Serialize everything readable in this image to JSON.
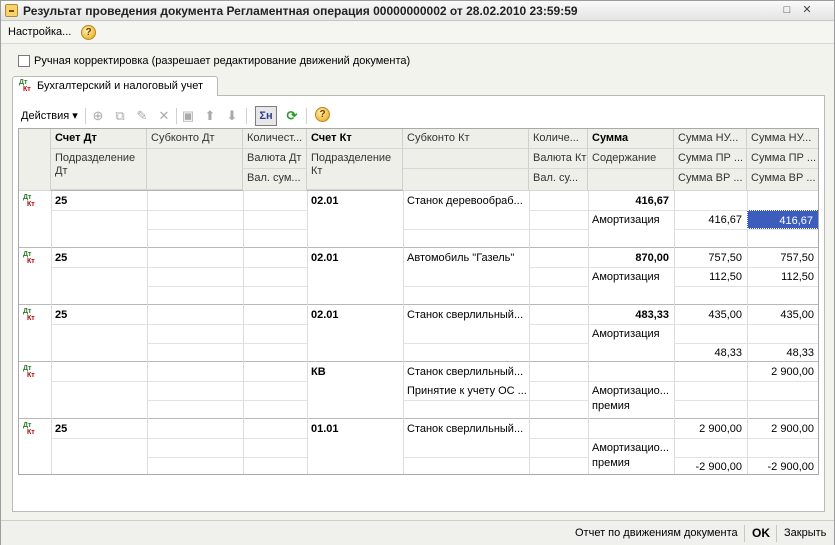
{
  "window": {
    "title": "Результат проведения документа Регламентная операция 00000000002 от 28.02.2010 23:59:59",
    "maximize_glyph": "□",
    "close_glyph": "✕"
  },
  "menu": {
    "settings_label": "Настройка...",
    "help_glyph": "?"
  },
  "manual_correction": {
    "label": "Ручная корректировка (разрешает редактирование движений документа)",
    "checked": false
  },
  "tab": {
    "label": "Бухгалтерский и налоговый учет",
    "icon_dt": "Дт",
    "icon_kt": "Кт"
  },
  "toolbar": {
    "actions_label": "Действия ▾",
    "sum_label": "Σн",
    "icons": [
      "add-icon",
      "copy-icon",
      "edit-icon",
      "delete-icon",
      "save-icon",
      "move-up-icon",
      "move-down-icon",
      "sum-icon",
      "refresh-icon",
      "help-icon"
    ]
  },
  "grid": {
    "headers": {
      "schet_dt": "Счет Дт",
      "subkonto_dt": "Субконто Дт",
      "kolichestvo_dt": "Количест...",
      "schet_kt": "Счет Кт",
      "subkonto_kt": "Субконто Кт",
      "kolichestvo_kt": "Количе...",
      "summa": "Сумма",
      "summa_nu_dt": "Сумма НУ...",
      "summa_nu_kt": "Сумма НУ...",
      "podrazdelenie_dt": "Подразделение Дт",
      "valyuta_dt": "Валюта Дт",
      "podrazdelenie_kt": "Подразделение Кт",
      "valyuta_kt": "Валюта Кт",
      "soderzhanie": "Содержание",
      "summa_pr_dt": "Сумма ПР ...",
      "summa_pr_kt": "Сумма ПР ...",
      "val_summa_dt": "Вал. сум...",
      "val_summa_kt": "Вал. су...",
      "summa_vr_dt": "Сумма ВР ...",
      "summa_vr_kt": "Сумма ВР ..."
    },
    "rows": [
      {
        "schet_dt": "25",
        "schet_kt": "02.01",
        "subkonto_kt": "Станок деревообраб...",
        "subkonto_kt2": "",
        "summa": "416,67",
        "soderzhanie": "Амортизация",
        "soderzhanie2": "",
        "nu_dt": "",
        "nu_kt": "",
        "pr_dt": "416,67",
        "pr_kt": "416,67",
        "vr_dt": "",
        "vr_kt": ""
      },
      {
        "schet_dt": "25",
        "schet_kt": "02.01",
        "subkonto_kt": "Автомобиль \"Газель\"",
        "subkonto_kt2": "",
        "summa": "870,00",
        "soderzhanie": "Амортизация",
        "soderzhanie2": "",
        "nu_dt": "757,50",
        "nu_kt": "757,50",
        "pr_dt": "112,50",
        "pr_kt": "112,50",
        "vr_dt": "",
        "vr_kt": ""
      },
      {
        "schet_dt": "25",
        "schet_kt": "02.01",
        "subkonto_kt": "Станок сверлильный...",
        "subkonto_kt2": "",
        "summa": "483,33",
        "soderzhanie": "Амортизация",
        "soderzhanie2": "",
        "nu_dt": "435,00",
        "nu_kt": "435,00",
        "pr_dt": "",
        "pr_kt": "",
        "vr_dt": "48,33",
        "vr_kt": "48,33"
      },
      {
        "schet_dt": "",
        "schet_kt": "КВ",
        "subkonto_kt": "Станок сверлильный...",
        "subkonto_kt2": "Принятие к учету ОС ...",
        "summa": "",
        "soderzhanie": "Амортизацио...",
        "soderzhanie2": "премия",
        "nu_dt": "",
        "nu_kt": "2 900,00",
        "pr_dt": "",
        "pr_kt": "",
        "vr_dt": "",
        "vr_kt": ""
      },
      {
        "schet_dt": "25",
        "schet_kt": "01.01",
        "subkonto_kt": "Станок сверлильный...",
        "subkonto_kt2": "",
        "summa": "",
        "soderzhanie": "Амортизацио...",
        "soderzhanie2": "премия",
        "nu_dt": "2 900,00",
        "nu_kt": "2 900,00",
        "pr_dt": "",
        "pr_kt": "",
        "vr_dt": "-2 900,00",
        "vr_kt": "-2 900,00"
      }
    ],
    "row_icon_dt": "Дт",
    "row_icon_kt": "Кт"
  },
  "footer": {
    "report_label": "Отчет по движениям документа",
    "ok_label": "OK",
    "close_label": "Закрыть"
  },
  "colors": {
    "selection": "#3d5dbd",
    "header_bg": "#efefea"
  }
}
